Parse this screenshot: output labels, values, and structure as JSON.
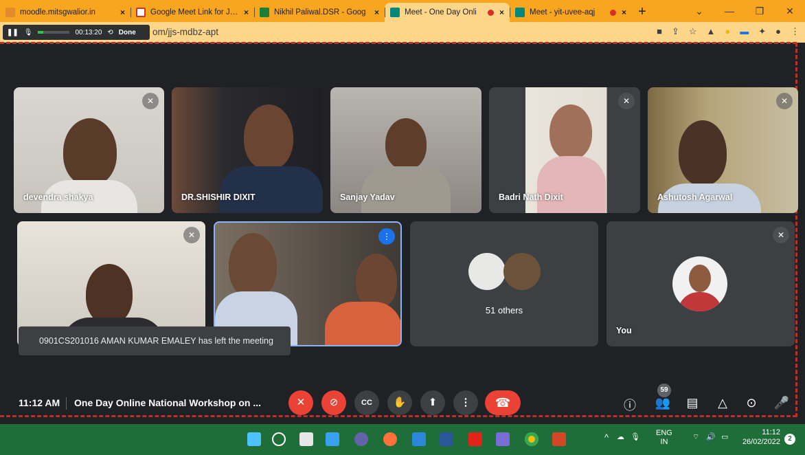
{
  "browser": {
    "tabs": [
      {
        "title": "moodle.mitsgwalior.in",
        "close": "×",
        "color": "#e28b2a"
      },
      {
        "title": "Google Meet Link for Join",
        "close": "×",
        "color": "#d93025"
      },
      {
        "title": "Nikhil Paliwal.DSR - Goog",
        "close": "×",
        "color": "#188038"
      },
      {
        "title": "Meet - One Day Onli",
        "close": "×",
        "color": "#00897b",
        "recording": true,
        "active": true
      },
      {
        "title": "Meet - yit-uvee-aqj",
        "close": "×",
        "color": "#00897b",
        "recording": true
      }
    ],
    "new_tab": "+",
    "url": "om/jjs-mdbz-apt",
    "recorder": {
      "time": "00:13:20",
      "done": "Done"
    }
  },
  "meeting": {
    "participants": [
      {
        "name": "devendra shakya",
        "muted": true
      },
      {
        "name": "DR.SHISHIR DIXIT",
        "muted": false
      },
      {
        "name": "Sanjay Yadav",
        "muted": false
      },
      {
        "name": "Badri Nath Dixit",
        "muted": true
      },
      {
        "name": "Ashutosh Agarwal",
        "muted": true
      },
      {
        "name": "",
        "muted": true
      },
      {
        "name": "",
        "muted": false,
        "speaking": true
      },
      {
        "name": "51 others"
      },
      {
        "name": "You",
        "muted": true
      }
    ],
    "toast": "0901CS201016 AMAN KUMAR EMALEY has left the meeting",
    "time": "11:12 AM",
    "title": "One Day Online National Workshop on ...",
    "participant_count": "59"
  },
  "taskbar": {
    "lang_top": "ENG",
    "lang_bottom": "IN",
    "time": "11:12",
    "date": "26/02/2022",
    "notifications": "2"
  }
}
